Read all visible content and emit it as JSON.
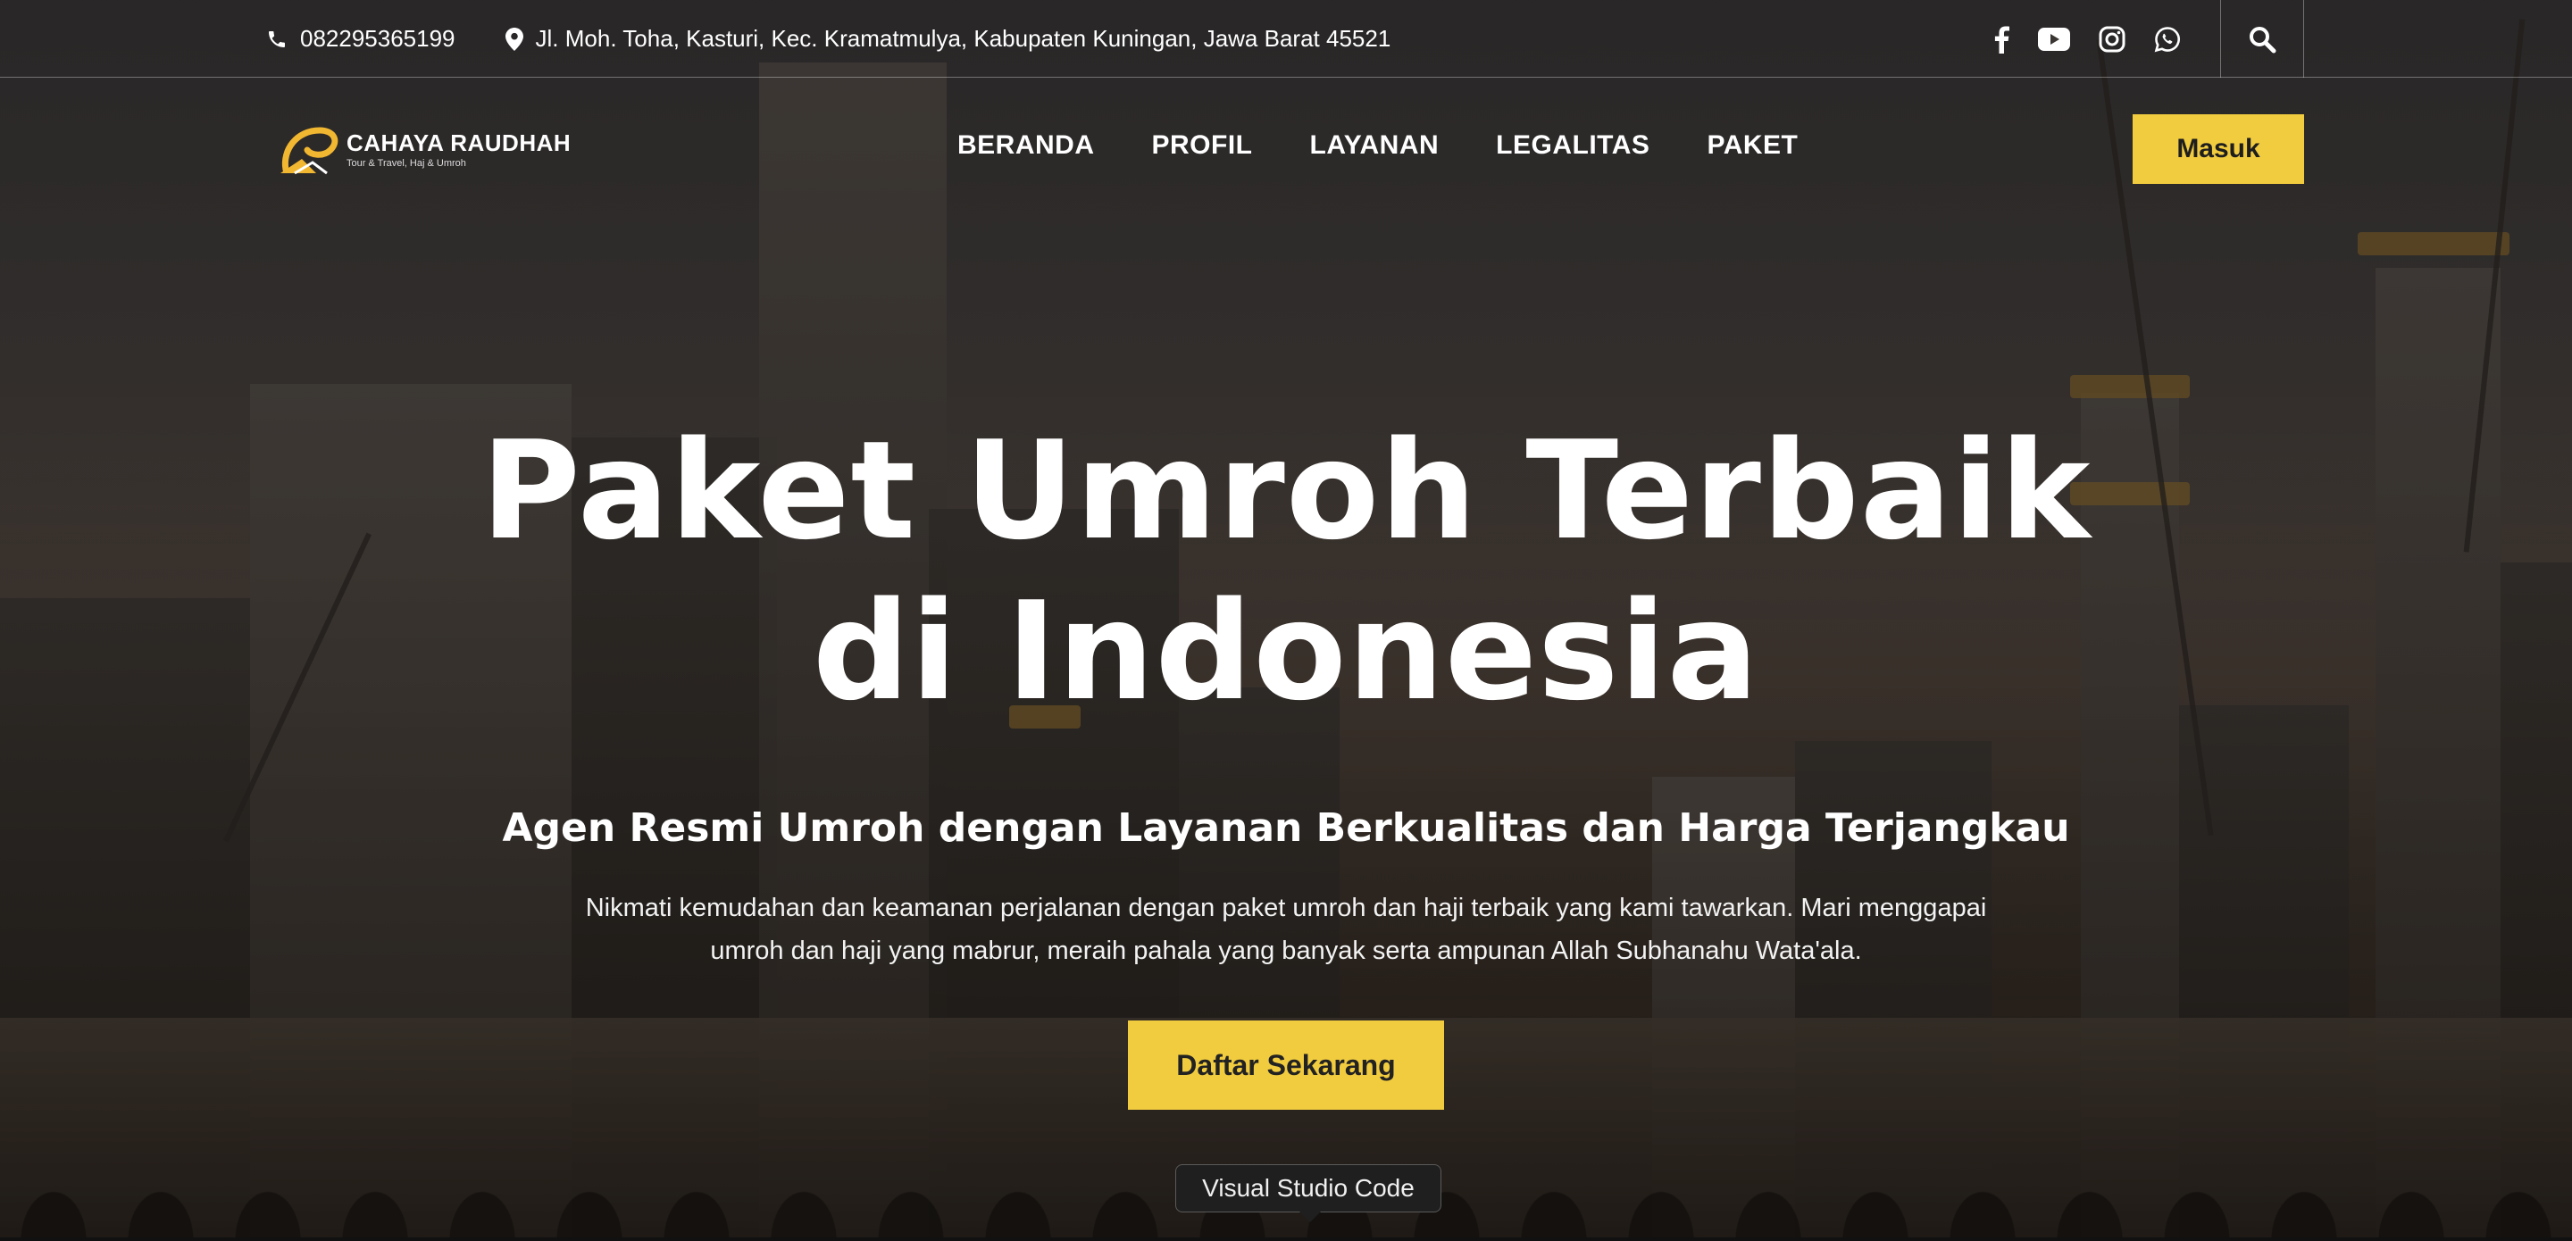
{
  "topbar": {
    "phone": "082295365199",
    "address": "Jl. Moh. Toha, Kasturi, Kec. Kramatmulya, Kabupaten Kuningan, Jawa Barat 45521",
    "social_icons": [
      "facebook-icon",
      "youtube-icon",
      "instagram-icon",
      "whatsapp-icon"
    ],
    "search_icon": "search-icon"
  },
  "brand": {
    "name": "CAHAYA RAUDHAH",
    "tagline": "Tour & Travel, Haj & Umroh",
    "accent": "#f2cc3f"
  },
  "nav": {
    "items": [
      "BERANDA",
      "PROFIL",
      "LAYANAN",
      "LEGALITAS",
      "PAKET"
    ],
    "login_label": "Masuk"
  },
  "hero": {
    "title_line1": "Paket Umroh Terbaik",
    "title_line2": "di Indonesia",
    "subtitle": "Agen Resmi Umroh dengan Layanan Berkualitas dan Harga Terjangkau",
    "description": "Nikmati kemudahan dan keamanan perjalanan dengan paket umroh dan haji terbaik yang kami tawarkan. Mari menggapai umroh dan haji yang mabrur, meraih pahala yang banyak serta ampunan Allah Subhanahu Wata'ala.",
    "cta_label": "Daftar Sekarang"
  },
  "tooltip": {
    "text": "Visual Studio Code"
  }
}
